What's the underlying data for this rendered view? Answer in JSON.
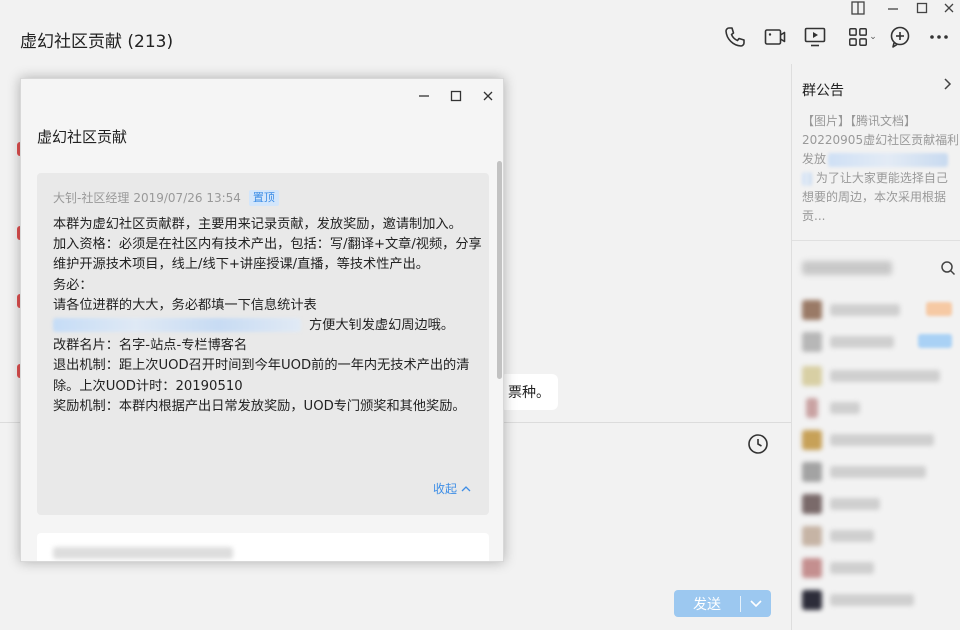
{
  "window": {
    "title": "虚幻社区贡献 (213)",
    "controls": [
      "pin-icon",
      "minimize-icon",
      "maximize-icon",
      "close-icon"
    ]
  },
  "toolbar": {
    "icons": [
      "phone-icon",
      "video-call-icon",
      "screen-share-icon",
      "apps-icon",
      "add-member-icon",
      "more-icon"
    ]
  },
  "chat": {
    "message_fragment": "票种。",
    "send_label": "发送"
  },
  "popup": {
    "title": "虚幻社区贡献",
    "notice": {
      "author": "大钊-社区经理",
      "timestamp": "2019/07/26 13:54",
      "pin_badge": "置顶",
      "lines": [
        "本群为虚幻社区贡献群，主要用来记录贡献，发放奖励，邀请制加入。",
        "加入资格：必须是在社区内有技术产出，包括：写/翻译+文章/视频，分享维护开源技术项目，线上/线下+讲座授课/直播，等技术性产出。",
        "务必：",
        "请各位进群的大大，务必都填一下信息统计表",
        "方便大钊发虚幻周边哦。",
        "改群名片：名字-站点-专栏博客名",
        "退出机制：距上次UOD召开时间到今年UOD前的一年内无技术产出的清除。上次UOD计时：20190510",
        "奖励机制：本群内根据产出日常发放奖励，UOD专门颁奖和其他奖励。"
      ],
      "collapse_label": "收起"
    }
  },
  "right_panel": {
    "notice_title": "群公告",
    "notice_tags": "【图片】【腾讯文档】",
    "notice_line1": "20220905虚幻社区贡献福利",
    "notice_line2_prefix": "发放",
    "notice_line3": "为了让大家更能选择自己想要的周边，本次采用根据贡..."
  }
}
